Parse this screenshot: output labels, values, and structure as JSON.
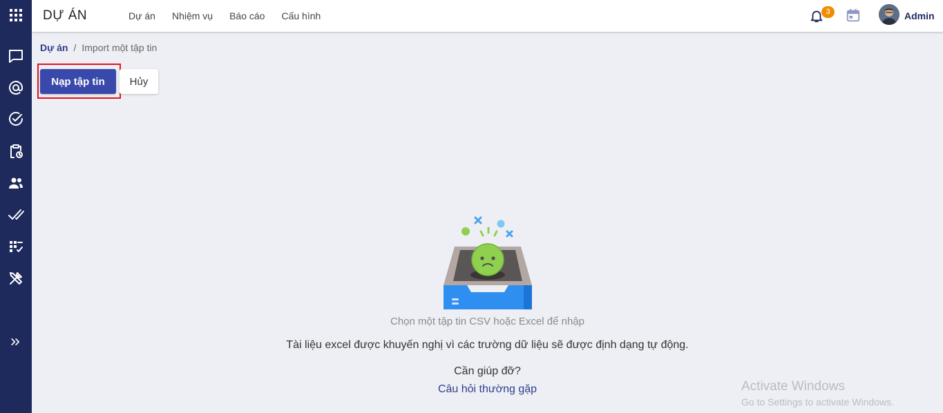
{
  "app": {
    "title": "DỰ ÁN"
  },
  "nav": {
    "items": [
      "Dự án",
      "Nhiệm vụ",
      "Báo cáo",
      "Cấu hình"
    ]
  },
  "header": {
    "notification_count": "3",
    "user_name": "Admin"
  },
  "breadcrumb": {
    "root": "Dự án",
    "separator": "/",
    "current": "Import một tập tin"
  },
  "actions": {
    "upload_label": "Nạp tập tin",
    "cancel_label": "Hủy"
  },
  "empty_state": {
    "primary": "Chọn một tập tin CSV hoặc Excel để nhập",
    "description": "Tài liệu excel được khuyến nghị vì các trường dữ liệu sẽ được định dạng tự động.",
    "help_question": "Cần giúp đỡ?",
    "faq_link": "Câu hỏi thường gặp"
  },
  "sidebar": {
    "icons": [
      "apps-grid-icon",
      "chat-icon",
      "at-mention-icon",
      "check-circle-icon",
      "clipboard-clock-icon",
      "people-icon",
      "double-check-icon",
      "checklist-icon",
      "tools-icon",
      "expand-chevrons-icon"
    ]
  },
  "watermark": {
    "title": "Activate Windows",
    "subtitle": "Go to Settings to activate Windows."
  },
  "colors": {
    "sidebar": "#1f2a5c",
    "primary": "#3949ab",
    "badge": "#f08c00",
    "highlight": "#e0141e",
    "background": "#eeeff4"
  }
}
